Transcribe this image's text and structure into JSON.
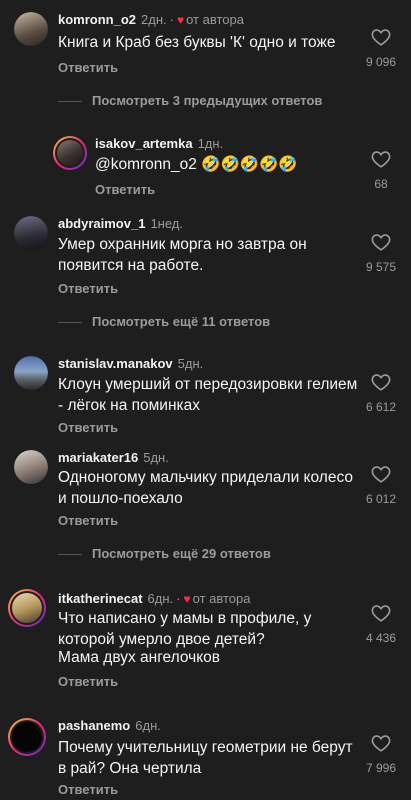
{
  "reply_label": "Ответить",
  "comments": [
    {
      "user": "komronn_o2",
      "time": "2дн.",
      "author_like": true,
      "author_label": "от автора",
      "text": "Книга и Краб без буквы 'К' одно и тоже",
      "likes": "9 096"
    },
    {
      "user": "isakov_artemka",
      "time": "1дн.",
      "text": "@komronn_o2 🤣🤣🤣🤣🤣",
      "likes": "68"
    },
    {
      "user": "abdyraimov_1",
      "time": "1нед.",
      "text": "Умер охранник морга но завтра он появится на работе.",
      "likes": "9 575"
    },
    {
      "user": "stanislav.manakov",
      "time": "5дн.",
      "text": "Клоун умерший от передозировки гелием - лёгок на поминках",
      "likes": "6 612"
    },
    {
      "user": "mariakater16",
      "time": "5дн.",
      "text": "Одноногому мальчику приделали колесо и пошло-поехало",
      "likes": "6 012"
    },
    {
      "user": "itkatherinecat",
      "time": "6дн.",
      "author_like": true,
      "author_label": "от автора",
      "text": "Что написано у мамы в профиле, у которой умерло двое детей?",
      "text2": "Мама двух ангелочков",
      "likes": "4 436"
    },
    {
      "user": "pashanemo",
      "time": "6дн.",
      "text": "Почему учительницу геометрии не берут в рай? Она чертила",
      "likes": "7 996"
    }
  ],
  "threads": [
    "Посмотреть 3 предыдущих ответов",
    "Посмотреть ещё 11 ответов",
    "Посмотреть ещё 29 ответов"
  ],
  "colors": {
    "background": "#1e1e1e",
    "heart": "#ff3040",
    "muted": "#9b9b9b"
  }
}
